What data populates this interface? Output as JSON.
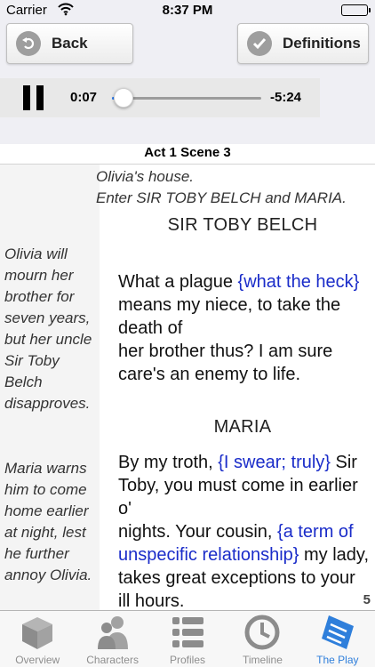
{
  "status_bar": {
    "carrier": "Carrier",
    "time": "8:37 PM",
    "battery_level": 1.0
  },
  "toolbar": {
    "back_label": "Back",
    "definitions_label": "Definitions"
  },
  "player": {
    "elapsed": "0:07",
    "remaining": "-5:24",
    "progress": 0.02,
    "state": "playing"
  },
  "scene": {
    "title": "Act 1 Scene 3",
    "page_number": "5"
  },
  "stage_direction": [
    "Olivia's house.",
    "Enter SIR TOBY BELCH and MARIA."
  ],
  "blocks": [
    {
      "speaker": "SIR TOBY BELCH",
      "note": "Olivia will mourn her brother for seven years, but her uncle Sir Toby Belch disapproves.",
      "segments": [
        {
          "text": "What a plague "
        },
        {
          "text": "{what the heck}",
          "definition": true
        },
        {
          "text": " means my niece, to take the death of\nher brother thus? I am sure care's an enemy to life."
        }
      ]
    },
    {
      "speaker": "MARIA",
      "note": "Maria warns him to come home earlier at night, lest he further annoy Olivia.",
      "segments": [
        {
          "text": "By my troth, "
        },
        {
          "text": "{I swear; truly}",
          "definition": true
        },
        {
          "text": " Sir Toby, you must come in earlier o'\nnights. Your cousin, "
        },
        {
          "text": "{a term of unspecific relationship}",
          "definition": true
        },
        {
          "text": " my lady, takes great exceptions to your ill hours."
        }
      ]
    }
  ],
  "tabs": [
    {
      "label": "Overview",
      "icon": "cube-icon",
      "active": false
    },
    {
      "label": "Characters",
      "icon": "people-icon",
      "active": false
    },
    {
      "label": "Profiles",
      "icon": "list-icon",
      "active": false
    },
    {
      "label": "Timeline",
      "icon": "clock-icon",
      "active": false
    },
    {
      "label": "The Play",
      "icon": "scroll-icon",
      "active": true
    }
  ],
  "colors": {
    "definition_link": "#1a2cc9",
    "active_tab": "#2f7fdb",
    "inactive_tab": "#8e8e8e",
    "slider_fill": "#2a7df6"
  }
}
